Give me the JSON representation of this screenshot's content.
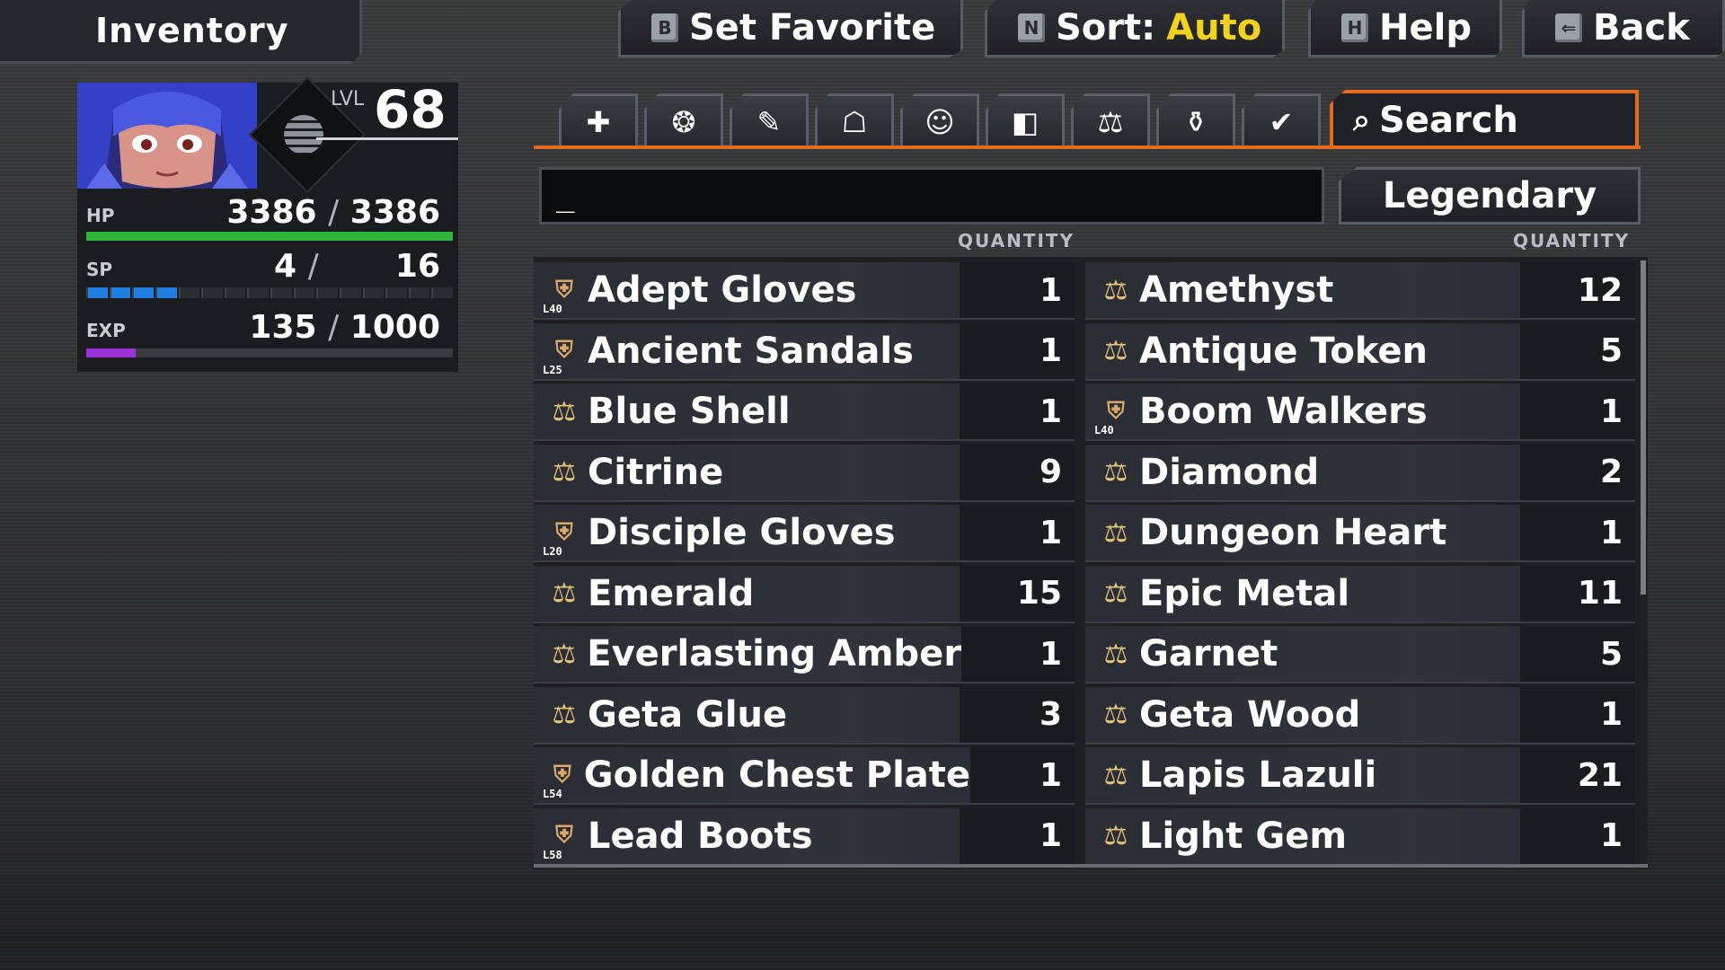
{
  "header": {
    "title": "Inventory",
    "buttons": [
      {
        "key": "B",
        "label": "Set Favorite"
      },
      {
        "key": "N",
        "label": "Sort:",
        "value": "Auto"
      },
      {
        "key": "H",
        "label": "Help"
      },
      {
        "key": "⇐",
        "label": "Back"
      }
    ]
  },
  "character": {
    "lvl_label": "LVL",
    "level": "68",
    "hp_label": "HP",
    "hp": "3386",
    "hp_max": "3386",
    "hp_fraction": 1.0,
    "sp_label": "SP",
    "sp": "4",
    "sp_max": "16",
    "sp_pips_filled": 4,
    "sp_pips_total": 16,
    "exp_label": "EXP",
    "exp": "135",
    "exp_max": "1000",
    "exp_fraction": 0.135,
    "slash": "/"
  },
  "tabs": {
    "icons": [
      "✚",
      "❂",
      "✎",
      "☖",
      "☺",
      "◧",
      "⚖",
      "⚱",
      "✔"
    ],
    "icon_names": [
      "items-icon",
      "arrows-icon",
      "weapon-icon",
      "helmet-icon",
      "armor-icon",
      "boots-icon",
      "trade-icon",
      "key-item-icon",
      "favorites-icon"
    ],
    "search_label": "Search"
  },
  "search": {
    "value": "_",
    "filter_label": "Legendary"
  },
  "list": {
    "quantity_header": "QUANTITY",
    "left": [
      {
        "name": "Adept Gloves",
        "qty": "1",
        "type": "equip",
        "level": "L40"
      },
      {
        "name": "Ancient Sandals",
        "qty": "1",
        "type": "equip",
        "level": "L25"
      },
      {
        "name": "Blue Shell",
        "qty": "1",
        "type": "trade"
      },
      {
        "name": "Citrine",
        "qty": "9",
        "type": "trade"
      },
      {
        "name": "Disciple Gloves",
        "qty": "1",
        "type": "equip",
        "level": "L20"
      },
      {
        "name": "Emerald",
        "qty": "15",
        "type": "trade"
      },
      {
        "name": "Everlasting Amber",
        "qty": "1",
        "type": "trade"
      },
      {
        "name": "Geta Glue",
        "qty": "3",
        "type": "trade"
      },
      {
        "name": "Golden Chest Plate",
        "qty": "1",
        "type": "equip",
        "level": "L54"
      },
      {
        "name": "Lead Boots",
        "qty": "1",
        "type": "equip",
        "level": "L58"
      }
    ],
    "right": [
      {
        "name": "Amethyst",
        "qty": "12",
        "type": "trade"
      },
      {
        "name": "Antique Token",
        "qty": "5",
        "type": "trade"
      },
      {
        "name": "Boom Walkers",
        "qty": "1",
        "type": "equip",
        "level": "L40"
      },
      {
        "name": "Diamond",
        "qty": "2",
        "type": "trade"
      },
      {
        "name": "Dungeon Heart",
        "qty": "1",
        "type": "trade"
      },
      {
        "name": "Epic Metal",
        "qty": "11",
        "type": "trade"
      },
      {
        "name": "Garnet",
        "qty": "5",
        "type": "trade"
      },
      {
        "name": "Geta Wood",
        "qty": "1",
        "type": "trade"
      },
      {
        "name": "Lapis Lazuli",
        "qty": "21",
        "type": "trade"
      },
      {
        "name": "Light Gem",
        "qty": "1",
        "type": "trade"
      }
    ]
  }
}
